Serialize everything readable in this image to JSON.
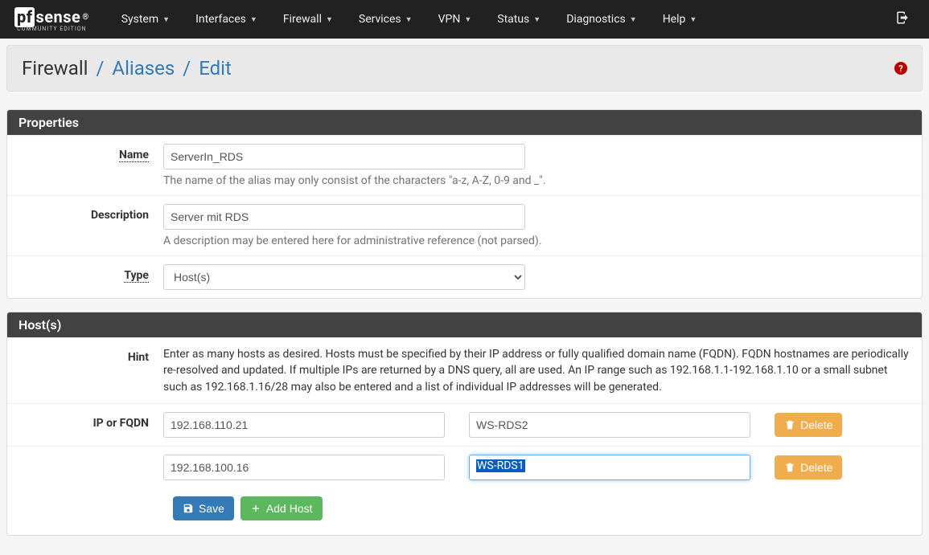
{
  "nav": {
    "items": [
      "System",
      "Interfaces",
      "Firewall",
      "Services",
      "VPN",
      "Status",
      "Diagnostics",
      "Help"
    ]
  },
  "breadcrumb": {
    "root": "Firewall",
    "mid": "Aliases",
    "leaf": "Edit"
  },
  "properties": {
    "heading": "Properties",
    "name_label": "Name",
    "name_value": "ServerIn_RDS",
    "name_help": "The name of the alias may only consist of the characters \"a-z, A-Z, 0-9 and _\".",
    "desc_label": "Description",
    "desc_value": "Server mit RDS",
    "desc_help": "A description may be entered here for administrative reference (not parsed).",
    "type_label": "Type",
    "type_value": "Host(s)"
  },
  "hosts": {
    "heading": "Host(s)",
    "hint_label": "Hint",
    "hint_text": "Enter as many hosts as desired. Hosts must be specified by their IP address or fully qualified domain name (FQDN). FQDN hostnames are periodically re-resolved and updated. If multiple IPs are returned by a DNS query, all are used. An IP range such as 192.168.1.1-192.168.1.10 or a small subnet such as 192.168.1.16/28 may also be entered and a list of individual IP addresses will be generated.",
    "ip_label": "IP or FQDN",
    "entries": [
      {
        "ip": "192.168.110.21",
        "desc": "WS-RDS2"
      },
      {
        "ip": "192.168.100.16",
        "desc": "WS-RDS1"
      }
    ],
    "delete_label": "Delete"
  },
  "buttons": {
    "save": "Save",
    "add_host": "Add Host"
  }
}
